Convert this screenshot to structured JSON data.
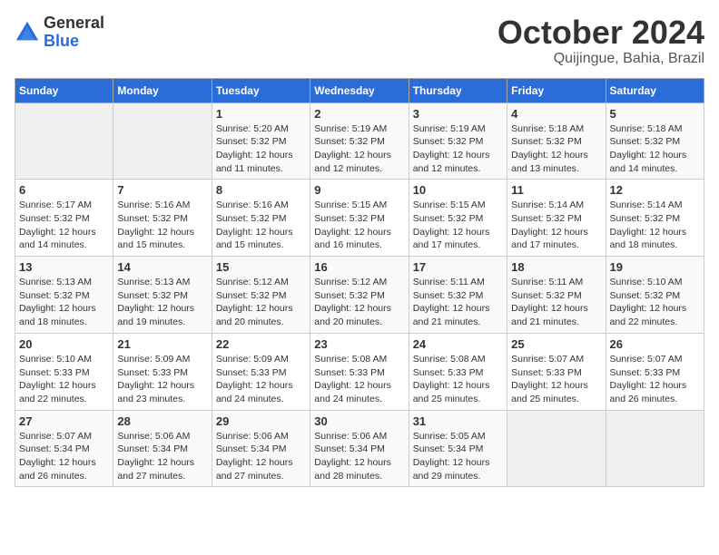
{
  "header": {
    "logo": {
      "general": "General",
      "blue": "Blue"
    },
    "title": "October 2024",
    "subtitle": "Quijingue, Bahia, Brazil"
  },
  "weekdays": [
    "Sunday",
    "Monday",
    "Tuesday",
    "Wednesday",
    "Thursday",
    "Friday",
    "Saturday"
  ],
  "weeks": [
    [
      {
        "day": null
      },
      {
        "day": null
      },
      {
        "day": "1",
        "sunrise": "Sunrise: 5:20 AM",
        "sunset": "Sunset: 5:32 PM",
        "daylight": "Daylight: 12 hours and 11 minutes."
      },
      {
        "day": "2",
        "sunrise": "Sunrise: 5:19 AM",
        "sunset": "Sunset: 5:32 PM",
        "daylight": "Daylight: 12 hours and 12 minutes."
      },
      {
        "day": "3",
        "sunrise": "Sunrise: 5:19 AM",
        "sunset": "Sunset: 5:32 PM",
        "daylight": "Daylight: 12 hours and 12 minutes."
      },
      {
        "day": "4",
        "sunrise": "Sunrise: 5:18 AM",
        "sunset": "Sunset: 5:32 PM",
        "daylight": "Daylight: 12 hours and 13 minutes."
      },
      {
        "day": "5",
        "sunrise": "Sunrise: 5:18 AM",
        "sunset": "Sunset: 5:32 PM",
        "daylight": "Daylight: 12 hours and 14 minutes."
      }
    ],
    [
      {
        "day": "6",
        "sunrise": "Sunrise: 5:17 AM",
        "sunset": "Sunset: 5:32 PM",
        "daylight": "Daylight: 12 hours and 14 minutes."
      },
      {
        "day": "7",
        "sunrise": "Sunrise: 5:16 AM",
        "sunset": "Sunset: 5:32 PM",
        "daylight": "Daylight: 12 hours and 15 minutes."
      },
      {
        "day": "8",
        "sunrise": "Sunrise: 5:16 AM",
        "sunset": "Sunset: 5:32 PM",
        "daylight": "Daylight: 12 hours and 15 minutes."
      },
      {
        "day": "9",
        "sunrise": "Sunrise: 5:15 AM",
        "sunset": "Sunset: 5:32 PM",
        "daylight": "Daylight: 12 hours and 16 minutes."
      },
      {
        "day": "10",
        "sunrise": "Sunrise: 5:15 AM",
        "sunset": "Sunset: 5:32 PM",
        "daylight": "Daylight: 12 hours and 17 minutes."
      },
      {
        "day": "11",
        "sunrise": "Sunrise: 5:14 AM",
        "sunset": "Sunset: 5:32 PM",
        "daylight": "Daylight: 12 hours and 17 minutes."
      },
      {
        "day": "12",
        "sunrise": "Sunrise: 5:14 AM",
        "sunset": "Sunset: 5:32 PM",
        "daylight": "Daylight: 12 hours and 18 minutes."
      }
    ],
    [
      {
        "day": "13",
        "sunrise": "Sunrise: 5:13 AM",
        "sunset": "Sunset: 5:32 PM",
        "daylight": "Daylight: 12 hours and 18 minutes."
      },
      {
        "day": "14",
        "sunrise": "Sunrise: 5:13 AM",
        "sunset": "Sunset: 5:32 PM",
        "daylight": "Daylight: 12 hours and 19 minutes."
      },
      {
        "day": "15",
        "sunrise": "Sunrise: 5:12 AM",
        "sunset": "Sunset: 5:32 PM",
        "daylight": "Daylight: 12 hours and 20 minutes."
      },
      {
        "day": "16",
        "sunrise": "Sunrise: 5:12 AM",
        "sunset": "Sunset: 5:32 PM",
        "daylight": "Daylight: 12 hours and 20 minutes."
      },
      {
        "day": "17",
        "sunrise": "Sunrise: 5:11 AM",
        "sunset": "Sunset: 5:32 PM",
        "daylight": "Daylight: 12 hours and 21 minutes."
      },
      {
        "day": "18",
        "sunrise": "Sunrise: 5:11 AM",
        "sunset": "Sunset: 5:32 PM",
        "daylight": "Daylight: 12 hours and 21 minutes."
      },
      {
        "day": "19",
        "sunrise": "Sunrise: 5:10 AM",
        "sunset": "Sunset: 5:32 PM",
        "daylight": "Daylight: 12 hours and 22 minutes."
      }
    ],
    [
      {
        "day": "20",
        "sunrise": "Sunrise: 5:10 AM",
        "sunset": "Sunset: 5:33 PM",
        "daylight": "Daylight: 12 hours and 22 minutes."
      },
      {
        "day": "21",
        "sunrise": "Sunrise: 5:09 AM",
        "sunset": "Sunset: 5:33 PM",
        "daylight": "Daylight: 12 hours and 23 minutes."
      },
      {
        "day": "22",
        "sunrise": "Sunrise: 5:09 AM",
        "sunset": "Sunset: 5:33 PM",
        "daylight": "Daylight: 12 hours and 24 minutes."
      },
      {
        "day": "23",
        "sunrise": "Sunrise: 5:08 AM",
        "sunset": "Sunset: 5:33 PM",
        "daylight": "Daylight: 12 hours and 24 minutes."
      },
      {
        "day": "24",
        "sunrise": "Sunrise: 5:08 AM",
        "sunset": "Sunset: 5:33 PM",
        "daylight": "Daylight: 12 hours and 25 minutes."
      },
      {
        "day": "25",
        "sunrise": "Sunrise: 5:07 AM",
        "sunset": "Sunset: 5:33 PM",
        "daylight": "Daylight: 12 hours and 25 minutes."
      },
      {
        "day": "26",
        "sunrise": "Sunrise: 5:07 AM",
        "sunset": "Sunset: 5:33 PM",
        "daylight": "Daylight: 12 hours and 26 minutes."
      }
    ],
    [
      {
        "day": "27",
        "sunrise": "Sunrise: 5:07 AM",
        "sunset": "Sunset: 5:34 PM",
        "daylight": "Daylight: 12 hours and 26 minutes."
      },
      {
        "day": "28",
        "sunrise": "Sunrise: 5:06 AM",
        "sunset": "Sunset: 5:34 PM",
        "daylight": "Daylight: 12 hours and 27 minutes."
      },
      {
        "day": "29",
        "sunrise": "Sunrise: 5:06 AM",
        "sunset": "Sunset: 5:34 PM",
        "daylight": "Daylight: 12 hours and 27 minutes."
      },
      {
        "day": "30",
        "sunrise": "Sunrise: 5:06 AM",
        "sunset": "Sunset: 5:34 PM",
        "daylight": "Daylight: 12 hours and 28 minutes."
      },
      {
        "day": "31",
        "sunrise": "Sunrise: 5:05 AM",
        "sunset": "Sunset: 5:34 PM",
        "daylight": "Daylight: 12 hours and 29 minutes."
      },
      {
        "day": null
      },
      {
        "day": null
      }
    ]
  ]
}
